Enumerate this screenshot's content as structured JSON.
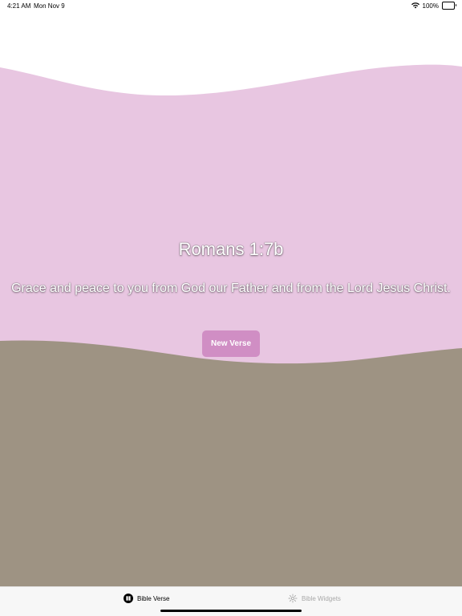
{
  "status_bar": {
    "time": "4:21 AM",
    "date": "Mon Nov 9",
    "battery_percent": "100%",
    "icons": [
      "wifi-icon",
      "battery-icon"
    ]
  },
  "colors": {
    "top_background": "#ffffff",
    "pink_wave": "#e8c6e1",
    "taupe_wave": "#9e9383",
    "button": "#d08ec4",
    "text": "#ffffff"
  },
  "verse": {
    "reference": "Romans 1:7b",
    "text": "Grace and peace to you from God our Father and from the Lord Jesus Christ."
  },
  "buttons": {
    "new_verse": "New Verse"
  },
  "tabs": [
    {
      "label": "Bible Verse",
      "icon": "book-icon",
      "selected": true
    },
    {
      "label": "Bible Widgets",
      "icon": "widget-icon",
      "selected": false
    }
  ]
}
